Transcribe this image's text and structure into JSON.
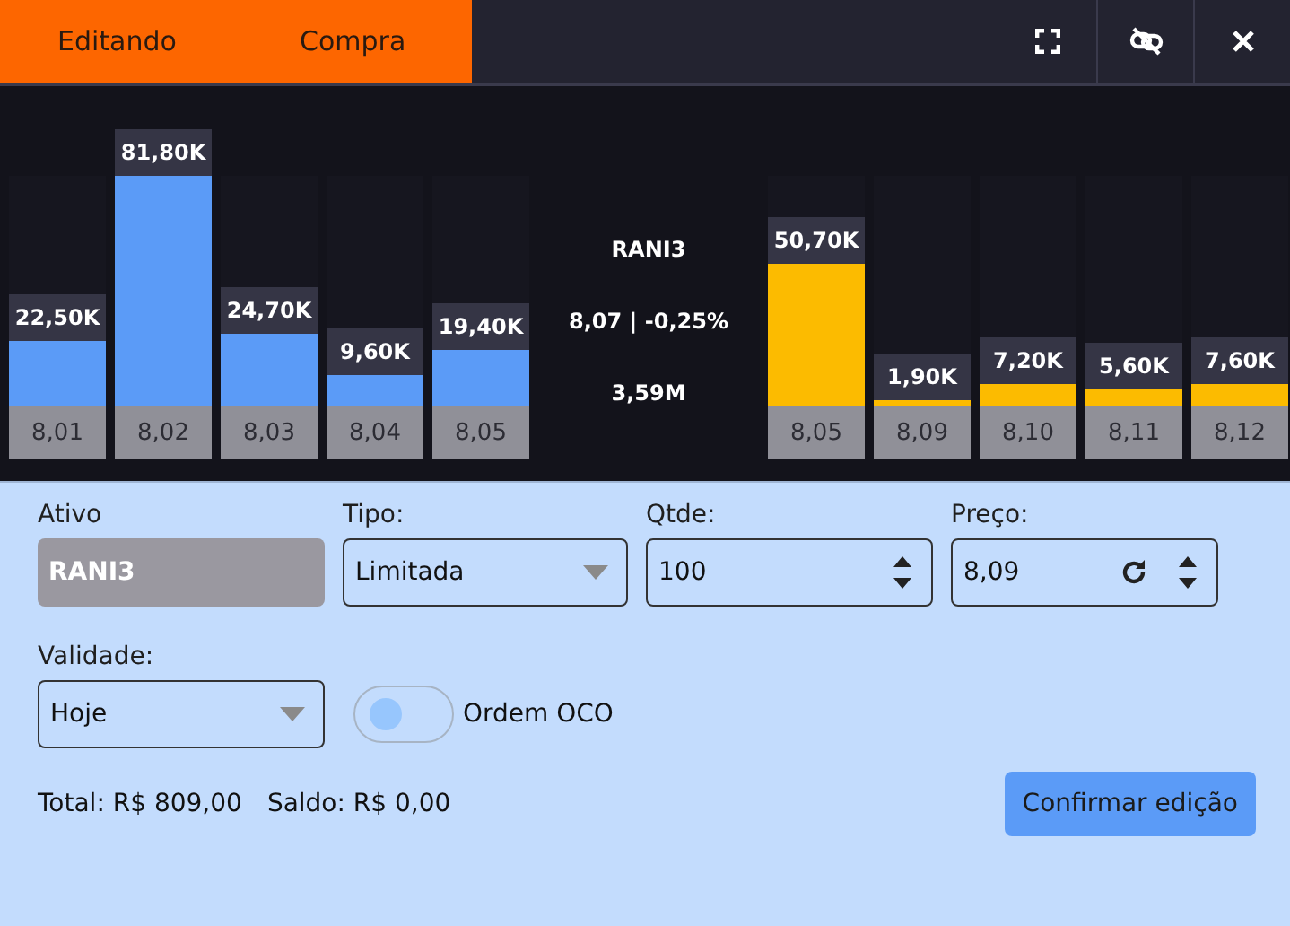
{
  "header": {
    "status": "Editando",
    "side": "Compra"
  },
  "book": {
    "bids": [
      {
        "quantity": "22,50K",
        "level": 0.28,
        "price": "8,01"
      },
      {
        "quantity": "81,80K",
        "level": 1,
        "price": "8,02"
      },
      {
        "quantity": "24,70K",
        "level": 0.31,
        "price": "8,03"
      },
      {
        "quantity": "9,60K",
        "level": 0.13,
        "price": "8,04"
      },
      {
        "quantity": "19,40K",
        "level": 0.24,
        "price": "8,05"
      }
    ],
    "summary": {
      "ticker": "RANI3",
      "quote": "8,07 | -0,25%",
      "volume": "3,59M"
    },
    "asks": [
      {
        "quantity": "50,70K",
        "level": 0.62,
        "price": "8,05"
      },
      {
        "quantity": "1,90K",
        "level": 0.025,
        "price": "8,09"
      },
      {
        "quantity": "7,20K",
        "level": 0.09,
        "price": "8,10"
      },
      {
        "quantity": "5,60K",
        "level": 0.07,
        "price": "8,11"
      },
      {
        "quantity": "7,60K",
        "level": 0.09,
        "price": "8,12"
      }
    ]
  },
  "form": {
    "fields": [
      {
        "kind": "readonly",
        "label": "Ativo",
        "value": "RANI3"
      },
      {
        "kind": "select",
        "label": "Tipo:",
        "value": "Limitada"
      },
      {
        "kind": "spinner",
        "label": "Qtde:",
        "value": "100"
      },
      {
        "kind": "price",
        "label": "Preço:",
        "value": "8,09"
      }
    ],
    "validity": {
      "label": "Validade:",
      "value": "Hoje"
    },
    "oco": {
      "label": "Ordem OCO",
      "on": false
    },
    "total": "Total: R$ 809,00",
    "balance": "Saldo: R$ 0,00",
    "confirm": "Confirmar edição"
  }
}
